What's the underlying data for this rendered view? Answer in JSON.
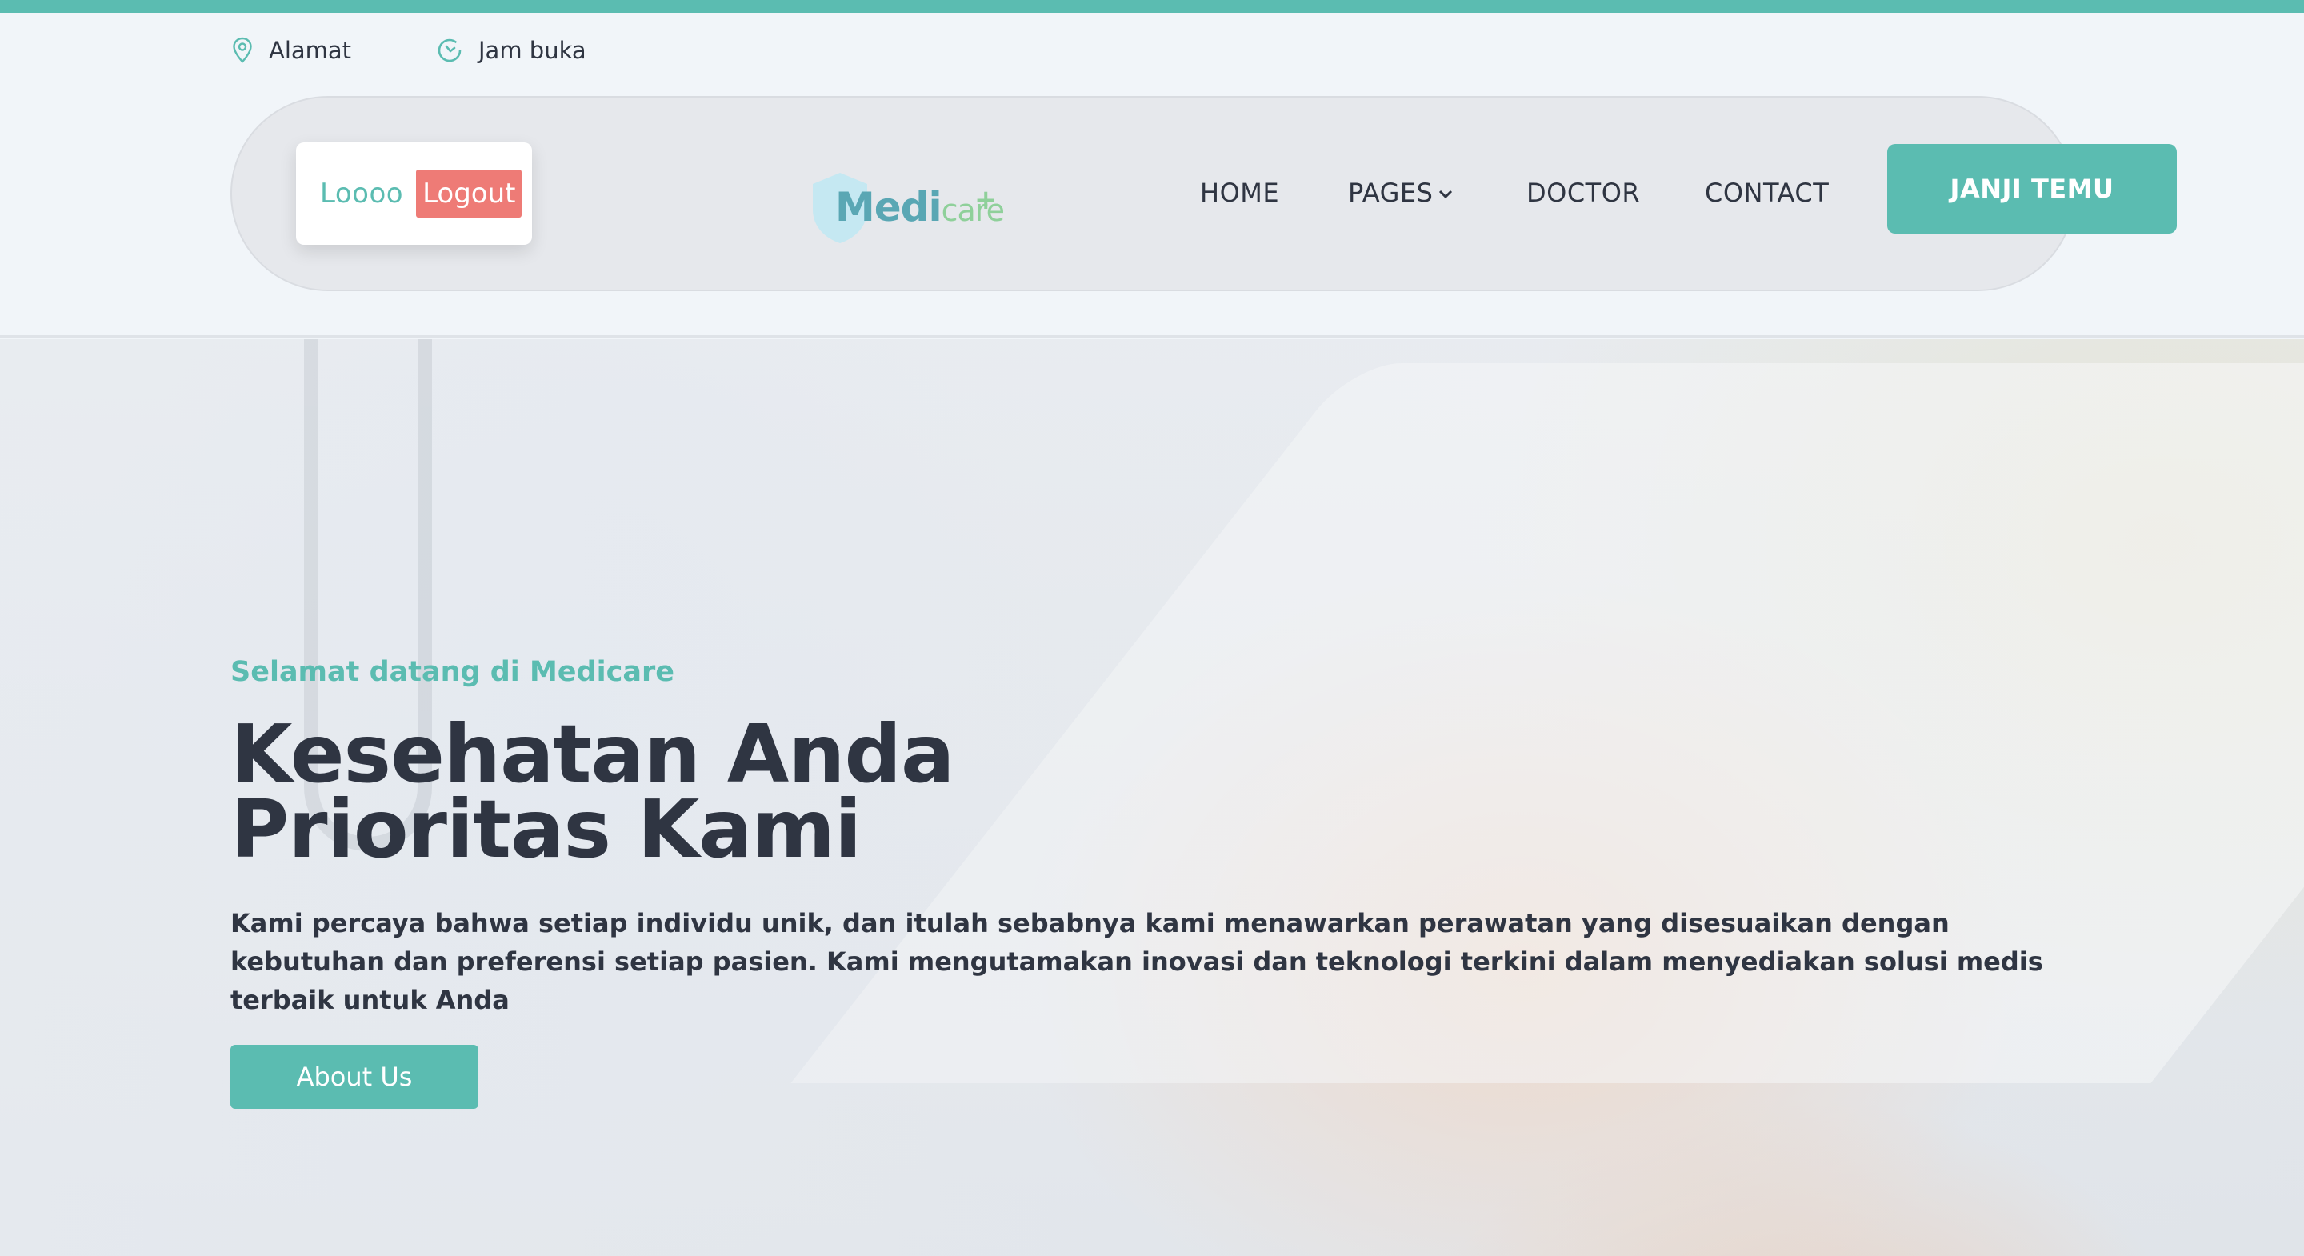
{
  "topbar": {
    "address_label": "Alamat",
    "hours_label": "Jam buka"
  },
  "nav": {
    "username": "Loooo",
    "logout_label": "Logout",
    "logo_medi": "Medi",
    "logo_care": "care",
    "links": [
      "HOME",
      "PAGES",
      "DOCTOR",
      "CONTACT"
    ],
    "cta_label": "JANJI TEMU"
  },
  "hero": {
    "subtitle": "Selamat datang di Medicare",
    "title_line1": "Kesehatan Anda",
    "title_line2": "Prioritas Kami",
    "description": "Kami percaya bahwa setiap individu unik, dan itulah sebabnya kami menawarkan perawatan yang disesuaikan dengan kebutuhan dan preferensi setiap pasien. Kami mengutamakan inovasi dan teknologi terkini dalam menyediakan solusi medis terbaik untuk Anda",
    "button_label": "About Us"
  },
  "colors": {
    "accent": "#5bbcb1",
    "logout": "#ee7b76",
    "text_dark": "#2f3542"
  },
  "icons": {
    "address": "map-pin-icon",
    "hours": "clock-icon",
    "pages_dropdown": "chevron-down-icon"
  }
}
